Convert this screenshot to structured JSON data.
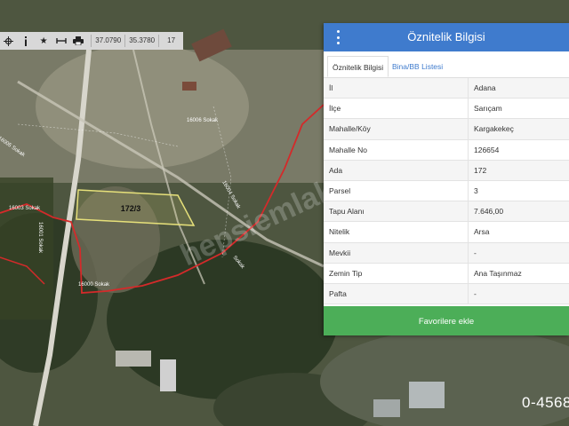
{
  "toolbar": {
    "icons": [
      "crosshair-icon",
      "info-icon",
      "star-icon",
      "measure-icon",
      "print-icon"
    ],
    "lon": "37.0790",
    "lat": "35.3780",
    "zoom": "17"
  },
  "map": {
    "parcel_label": "172/3",
    "street_labels": [
      "16003 Sokak",
      "16005 Sokak",
      "16006 Sokak",
      "16001 Sokak",
      "16004 Sokak",
      "16000 Sokak",
      "Sokak"
    ],
    "watermark": "hepsiemlak",
    "phone": "0-4568",
    "colors": {
      "boundary": "#d42a2a",
      "parcel": "#e6e07a"
    }
  },
  "panel": {
    "title": "Öznitelik Bilgisi",
    "tabs": [
      {
        "label": "Öznitelik Bilgisi",
        "active": true
      },
      {
        "label": "Bina/BB Listesi",
        "active": false
      }
    ],
    "rows": [
      {
        "key": "İl",
        "value": "Adana"
      },
      {
        "key": "İlçe",
        "value": "Sarıçam"
      },
      {
        "key": "Mahalle/Köy",
        "value": "Kargakekeç"
      },
      {
        "key": "Mahalle No",
        "value": "126654"
      },
      {
        "key": "Ada",
        "value": "172"
      },
      {
        "key": "Parsel",
        "value": "3"
      },
      {
        "key": "Tapu Alanı",
        "value": "7.646,00"
      },
      {
        "key": "Nitelik",
        "value": "Arsa"
      },
      {
        "key": "Mevkii",
        "value": "-"
      },
      {
        "key": "Zemin Tip",
        "value": "Ana Taşınmaz"
      },
      {
        "key": "Pafta",
        "value": "-"
      }
    ],
    "favorite_button": "Favorilere ekle",
    "colors": {
      "header": "#3f7bcd",
      "button": "#4cae58"
    }
  }
}
